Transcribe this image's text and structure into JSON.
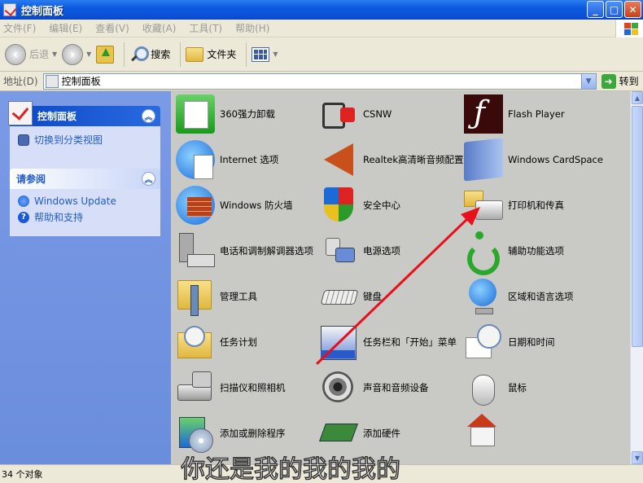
{
  "window": {
    "title": "控制面板",
    "buttons": [
      "_",
      "□",
      "✕"
    ]
  },
  "menu": {
    "items": [
      "文件(F)",
      "编辑(E)",
      "查看(V)",
      "收藏(A)",
      "工具(T)",
      "帮助(H)"
    ]
  },
  "toolbar": {
    "back_label": "后退",
    "search_label": "搜索",
    "folders_label": "文件夹"
  },
  "address": {
    "label": "地址(D)",
    "value": "控制面板",
    "go_label": "转到"
  },
  "sidebar": {
    "panel1": {
      "title": "控制面板",
      "tasks": [
        {
          "label": "切换到分类视图",
          "icon": "switch-view-icon"
        }
      ]
    },
    "panel2": {
      "title": "请参阅",
      "tasks": [
        {
          "label": "Windows Update",
          "icon": "windows-update-icon"
        },
        {
          "label": "帮助和支持",
          "icon": "help-icon"
        }
      ]
    }
  },
  "items": [
    {
      "label": "360强力卸载",
      "icon": "uninstall-icon"
    },
    {
      "label": "CSNW",
      "icon": "csnw-icon"
    },
    {
      "label": "Flash Player",
      "icon": "flash-icon"
    },
    {
      "label": "Internet 选项",
      "icon": "internet-options-icon"
    },
    {
      "label": "Realtek高清晰音频配置",
      "icon": "realtek-audio-icon"
    },
    {
      "label": "Windows CardSpace",
      "icon": "cardspace-icon"
    },
    {
      "label": "Windows 防火墙",
      "icon": "firewall-icon"
    },
    {
      "label": "安全中心",
      "icon": "security-center-icon"
    },
    {
      "label": "打印机和传真",
      "icon": "printer-icon"
    },
    {
      "label": "电话和调制解调器选项",
      "icon": "phone-modem-icon"
    },
    {
      "label": "电源选项",
      "icon": "power-options-icon"
    },
    {
      "label": "辅助功能选项",
      "icon": "accessibility-icon"
    },
    {
      "label": "管理工具",
      "icon": "admin-tools-icon"
    },
    {
      "label": "键盘",
      "icon": "keyboard-icon"
    },
    {
      "label": "区域和语言选项",
      "icon": "region-language-icon"
    },
    {
      "label": "任务计划",
      "icon": "scheduled-tasks-icon"
    },
    {
      "label": "任务栏和「开始」菜单",
      "icon": "taskbar-start-icon"
    },
    {
      "label": "日期和时间",
      "icon": "date-time-icon"
    },
    {
      "label": "扫描仪和照相机",
      "icon": "scanner-camera-icon"
    },
    {
      "label": "声音和音频设备",
      "icon": "sound-audio-icon"
    },
    {
      "label": "鼠标",
      "icon": "mouse-icon"
    },
    {
      "label": "添加或删除程序",
      "icon": "add-remove-programs-icon"
    },
    {
      "label": "添加硬件",
      "icon": "add-hardware-icon"
    },
    {
      "label": "",
      "icon": "home-icon"
    }
  ],
  "status": {
    "text": "34 个对象"
  },
  "overlay": {
    "subtitle": "你还是我的我的我的",
    "arrow_color": "#e8101a"
  }
}
